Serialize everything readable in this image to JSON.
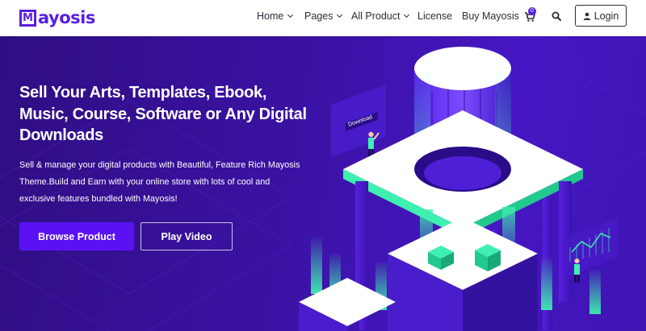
{
  "brand": {
    "logo_letter": "M",
    "name": "ayosis",
    "color": "#5a1fe0"
  },
  "nav": {
    "items": [
      {
        "label": "Home",
        "has_dropdown": true
      },
      {
        "label": "Pages",
        "has_dropdown": true
      },
      {
        "label": "All Product",
        "has_dropdown": true
      },
      {
        "label": "License",
        "has_dropdown": false
      },
      {
        "label": "Buy Mayosis",
        "has_dropdown": false
      }
    ],
    "cart_count": "0",
    "cart_icon": "cart-icon",
    "search_icon": "search-icon",
    "login_label": "Login",
    "login_icon": "user-icon"
  },
  "hero": {
    "title": "Sell Your Arts, Templates, Ebook, Music, Course, Software or Any Digital Downloads",
    "description": "Sell & manage your digital products with Beautiful, Feature Rich Mayosis Theme.Build and Earn with your online store with lots of cool and exclusive features bundled with Mayosis!",
    "primary_button": "Browse Product",
    "secondary_button": "Play Video",
    "illustration_sign": "Download",
    "colors": {
      "background": "#3a12a3",
      "accent": "#5a12f5",
      "mint": "#3ef0b0"
    }
  }
}
